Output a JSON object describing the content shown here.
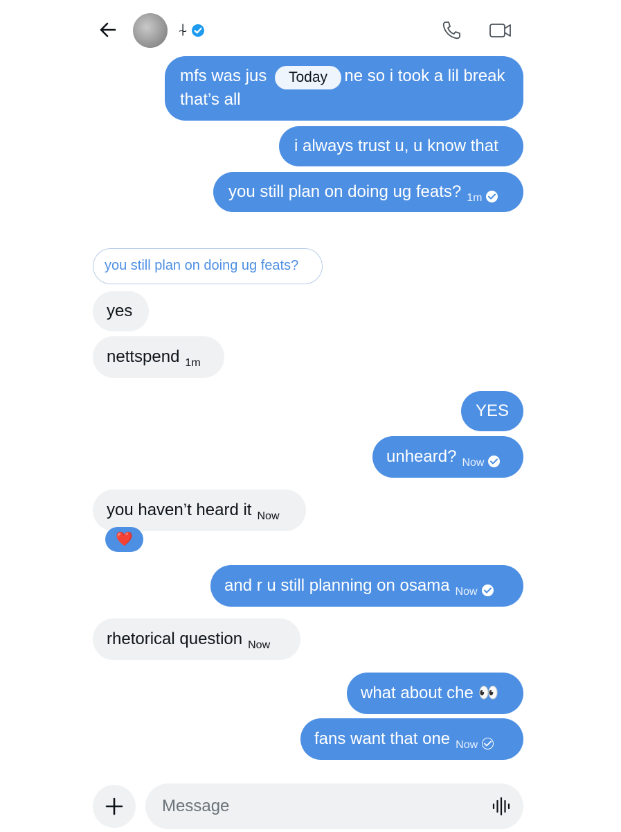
{
  "header": {
    "contact_name": "⍭",
    "verified_icon": "verified-badge-icon",
    "back_icon": "back-arrow-icon",
    "call_icon": "phone-icon",
    "video_icon": "video-camera-icon"
  },
  "date_divider": "Today",
  "messages": [
    {
      "direction": "outgoing",
      "text_before": "mfs was jus",
      "text_after": "ne so i took a lil break",
      "text_line2": "that’s all"
    },
    {
      "direction": "outgoing",
      "text": "i always trust u, u know that"
    },
    {
      "direction": "outgoing",
      "text": "you still plan on doing ug feats?",
      "time": "1m",
      "status": "read"
    },
    {
      "direction": "incoming",
      "reply_quote": "you still plan on doing ug feats?"
    },
    {
      "direction": "incoming",
      "text": "yes"
    },
    {
      "direction": "incoming",
      "text": "nettspend",
      "time": "1m"
    },
    {
      "direction": "outgoing",
      "text": "YES"
    },
    {
      "direction": "outgoing",
      "text": "unheard?",
      "time": "Now",
      "status": "read"
    },
    {
      "direction": "incoming",
      "text": "you haven’t heard it",
      "time": "Now",
      "reaction": "❤️"
    },
    {
      "direction": "outgoing",
      "text": "and r u still planning on osama",
      "time": "Now",
      "status": "read"
    },
    {
      "direction": "incoming",
      "text": "rhetorical question",
      "time": "Now"
    },
    {
      "direction": "outgoing",
      "text": "what about che 👀"
    },
    {
      "direction": "outgoing",
      "text": "fans want that one",
      "time": "Now",
      "status": "sent"
    }
  ],
  "composer": {
    "placeholder": "Message",
    "add_icon": "plus-icon",
    "voice_icon": "voice-wave-icon"
  },
  "colors": {
    "outgoing_bubble": "#4d8fe3",
    "incoming_bubble": "#eff1f3",
    "accent": "#1d9bf0"
  }
}
